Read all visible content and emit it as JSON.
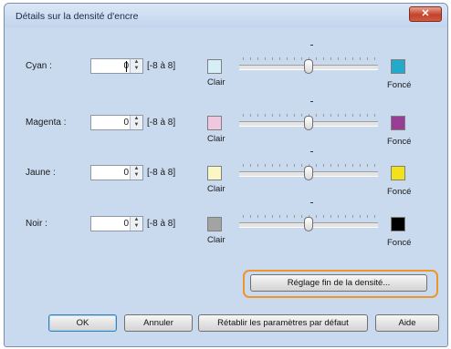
{
  "window": {
    "title": "Détails sur la densité d'encre",
    "close_glyph": "✕"
  },
  "range_label": "[-8 à 8]",
  "clair_label": "Clair",
  "fonce_label": "Foncé",
  "channels": [
    {
      "label": "Cyan :",
      "value": "0",
      "light_color": "#d6eef6",
      "dark_color": "#23a9c9",
      "slider_value": 0
    },
    {
      "label": "Magenta :",
      "value": "0",
      "light_color": "#f0c8de",
      "dark_color": "#9a3d95",
      "slider_value": 0
    },
    {
      "label": "Jaune :",
      "value": "0",
      "light_color": "#fbf6c6",
      "dark_color": "#f2e21a",
      "slider_value": 0
    },
    {
      "label": "Noir :",
      "value": "0",
      "light_color": "#a3a3a3",
      "dark_color": "#000000",
      "slider_value": 0
    }
  ],
  "buttons": {
    "fine_adjust": "Réglage fin de la densité...",
    "ok": "OK",
    "cancel": "Annuler",
    "restore_defaults": "Rétablir les paramètres par défaut",
    "help": "Aide"
  },
  "colors": {
    "highlight": "#f0942c"
  }
}
